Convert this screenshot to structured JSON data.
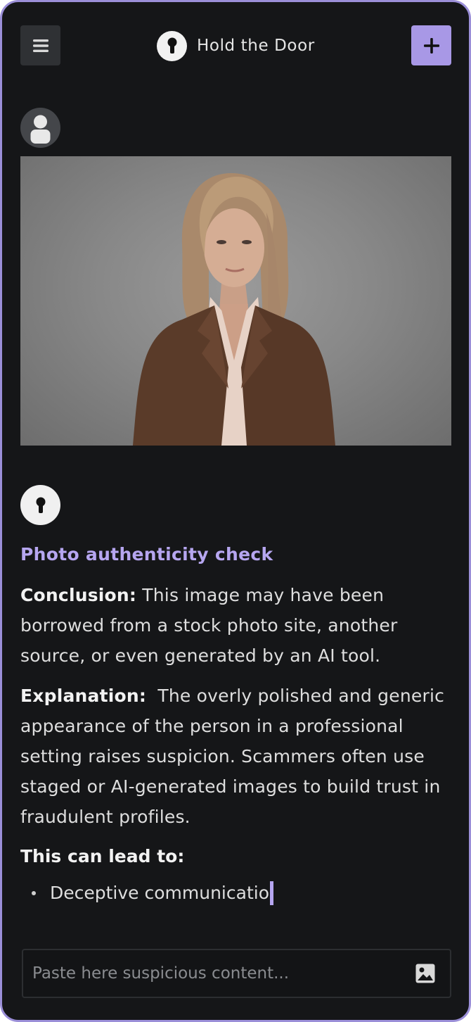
{
  "header": {
    "app_title": "Hold the Door",
    "menu_icon": "hamburger-menu-icon",
    "logo_icon": "keyhole-icon",
    "new_icon": "plus-icon"
  },
  "chat": {
    "user_avatar_icon": "user-icon",
    "bot_avatar_icon": "keyhole-icon",
    "response": {
      "title": "Photo authenticity check",
      "conclusion_label": "Conclusion:",
      "conclusion_text": " This image may have been borrowed from a stock photo site, another source, or even generated by an AI tool.",
      "explanation_label": "Explanation:",
      "explanation_text": "  The overly polished and generic appearance of the person in a professional setting raises suspicion. Scammers often use staged or AI-generated images to build trust in fraudulent profiles.",
      "lead_heading": "This can lead to:",
      "bullets": [
        "Deceptive communicatio"
      ]
    }
  },
  "composer": {
    "placeholder": "Paste here suspicious content...",
    "attach_icon": "image-icon"
  },
  "colors": {
    "accent": "#a898e6",
    "title_accent": "#b6a6f0",
    "background": "#151618",
    "border": "#9b8fd8"
  }
}
